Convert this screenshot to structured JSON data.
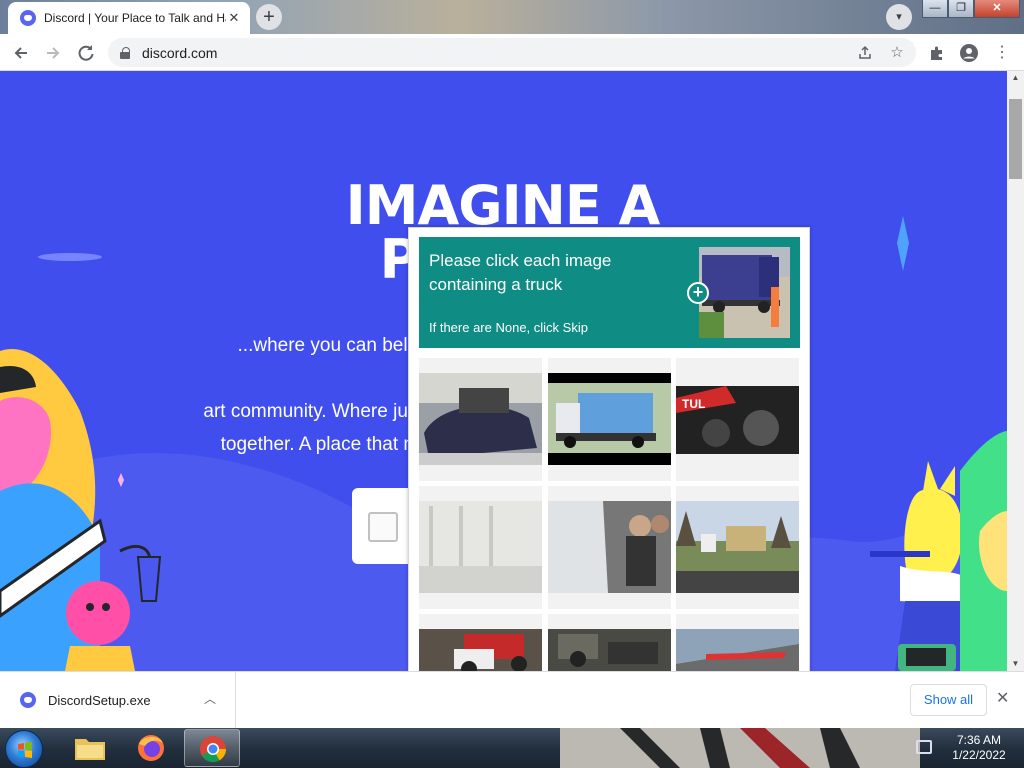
{
  "browser": {
    "tab_title": "Discord | Your Place to Talk and Hang Out",
    "tab_close": "✕",
    "new_tab": "+",
    "url": "discord.com",
    "window_buttons": {
      "minimize": "—",
      "maximize": "❐",
      "close": "✕"
    },
    "icons": [
      "back-arrow-icon",
      "forward-arrow-icon",
      "reload-icon",
      "lock-icon",
      "share-icon",
      "bookmark-star-icon",
      "extensions-puzzle-icon",
      "profile-icon",
      "more-menu-icon"
    ]
  },
  "page": {
    "hero_title": "IMAGINE A PLACE...",
    "hero_desc_line1": "...where you can belong to a school club, a gaming group, or a worldwide",
    "hero_desc_line2": "art community. Where just you and a handful of friends can spend time",
    "hero_desc_line3": "together. A place that makes it easy to talk every day and hang out more often.",
    "background_color": "#404eed"
  },
  "captcha": {
    "prompt": "Please click each image containing a truck",
    "skip_hint": "If there are None, click Skip",
    "header_color": "#0f8c84",
    "tiles": [
      "car-engine-repair",
      "blue-garbage-truck",
      "red-race-car",
      "snowy-fence",
      "vehicle-interior-people",
      "trees-and-building",
      "red-pickup-truck",
      "junkyard-vehicles",
      "car-spoiler"
    ]
  },
  "downloads": {
    "file_name": "DiscordSetup.exe",
    "show_all": "Show all",
    "close": "✕"
  },
  "taskbar": {
    "time": "7:36 AM",
    "date": "1/22/2022",
    "apps": [
      "windows-explorer",
      "firefox",
      "chrome"
    ]
  }
}
